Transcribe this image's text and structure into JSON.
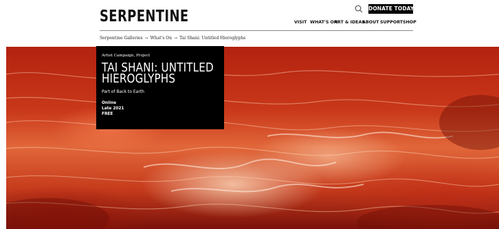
{
  "header": {
    "logo": "SERPENTINE",
    "donate_label": "DONATE TODAY"
  },
  "nav": {
    "items": [
      {
        "label": "VISIT"
      },
      {
        "label": "WHAT'S ON"
      },
      {
        "label": "ART & IDEAS"
      },
      {
        "label": "ABOUT"
      },
      {
        "label": "SUPPORT"
      },
      {
        "label": "SHOP"
      }
    ]
  },
  "breadcrumb": {
    "items": [
      "Serpentine Galleries",
      "What's On",
      "Tai Shani: Untitled Hieroglyphs"
    ],
    "separator": "→"
  },
  "card": {
    "eyebrow": "Artist Campaign, Project",
    "title_line1": "TAI SHANI: UNTITLED",
    "title_line2": "HIEROGLYPHS",
    "subtitle": "Part of Back to Earth",
    "meta": [
      "Online",
      "Late 2021",
      "FREE"
    ]
  },
  "colors": {
    "card_bg": "#000000",
    "hero_base": "#c9381a",
    "hero_highlight": "#ffe0c4"
  },
  "icons": {
    "search": "search-icon"
  }
}
